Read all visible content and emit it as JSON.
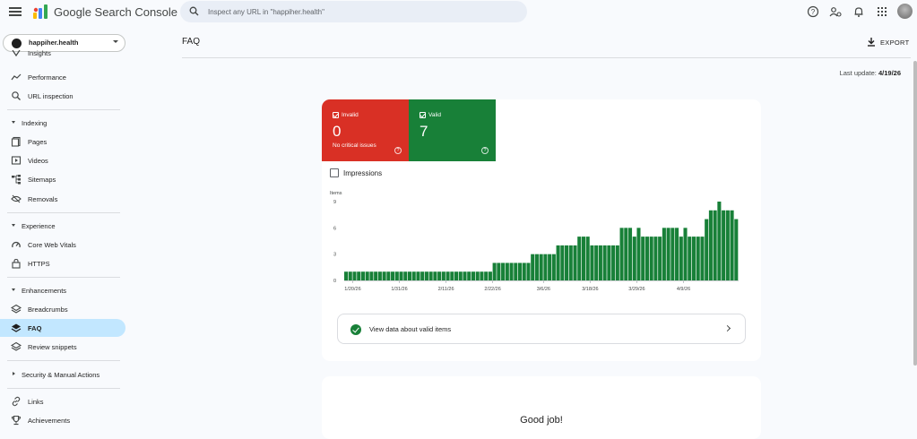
{
  "header": {
    "app_title": "Google Search Console",
    "search_placeholder": "Inspect any URL in \"happiher.health\""
  },
  "property": {
    "name": "happiher.health"
  },
  "sidebar": {
    "top_items": [
      {
        "label": "Insights",
        "icon": "insights-icon"
      },
      {
        "label": "Performance",
        "icon": "trend-icon"
      },
      {
        "label": "URL inspection",
        "icon": "search-icon"
      }
    ],
    "sections": [
      {
        "title": "Indexing",
        "items": [
          "Pages",
          "Videos",
          "Sitemaps",
          "Removals"
        ]
      },
      {
        "title": "Experience",
        "items": [
          "Core Web Vitals",
          "HTTPS"
        ]
      },
      {
        "title": "Enhancements",
        "items": [
          "Breadcrumbs",
          "FAQ",
          "Review snippets"
        ]
      },
      {
        "title": "Security & Manual Actions",
        "items": []
      }
    ],
    "bottom_items": [
      "Links",
      "Achievements"
    ],
    "active_item": "FAQ"
  },
  "page": {
    "title": "FAQ",
    "export_label": "EXPORT",
    "last_update_label": "Last update:",
    "last_update_value": "4/19/26"
  },
  "summary": {
    "invalid": {
      "label": "Invalid",
      "value": "0",
      "sub": "No critical issues"
    },
    "valid": {
      "label": "Valid",
      "value": "7"
    }
  },
  "impressions_label": "Impressions",
  "valid_link_label": "View data about valid items",
  "good_job": "Good job!",
  "colors": {
    "invalid": "#d93025",
    "valid": "#188038",
    "active_nav": "#c2e7ff"
  },
  "chart_data": {
    "type": "bar",
    "ylabel": "Items",
    "yticks": [
      0,
      3,
      6,
      9
    ],
    "ylim": [
      0,
      9
    ],
    "xticks": [
      "1/20/26",
      "1/31/26",
      "2/11/26",
      "2/22/26",
      "3/6/26",
      "3/18/26",
      "3/29/26",
      "4/9/26"
    ],
    "values": [
      1,
      1,
      1,
      1,
      1,
      1,
      1,
      1,
      1,
      1,
      1,
      1,
      1,
      1,
      1,
      1,
      1,
      1,
      1,
      1,
      1,
      1,
      1,
      1,
      1,
      1,
      1,
      1,
      1,
      1,
      1,
      1,
      1,
      1,
      1,
      2,
      2,
      2,
      2,
      2,
      2,
      2,
      2,
      2,
      3,
      3,
      3,
      3,
      3,
      3,
      4,
      4,
      4,
      4,
      4,
      5,
      5,
      5,
      4,
      4,
      4,
      4,
      4,
      4,
      4,
      6,
      6,
      6,
      5,
      6,
      5,
      5,
      5,
      5,
      5,
      6,
      6,
      6,
      6,
      5,
      6,
      5,
      5,
      5,
      5,
      7,
      8,
      8,
      9,
      8,
      8,
      8,
      7
    ],
    "color": "#188038",
    "grid": false
  }
}
